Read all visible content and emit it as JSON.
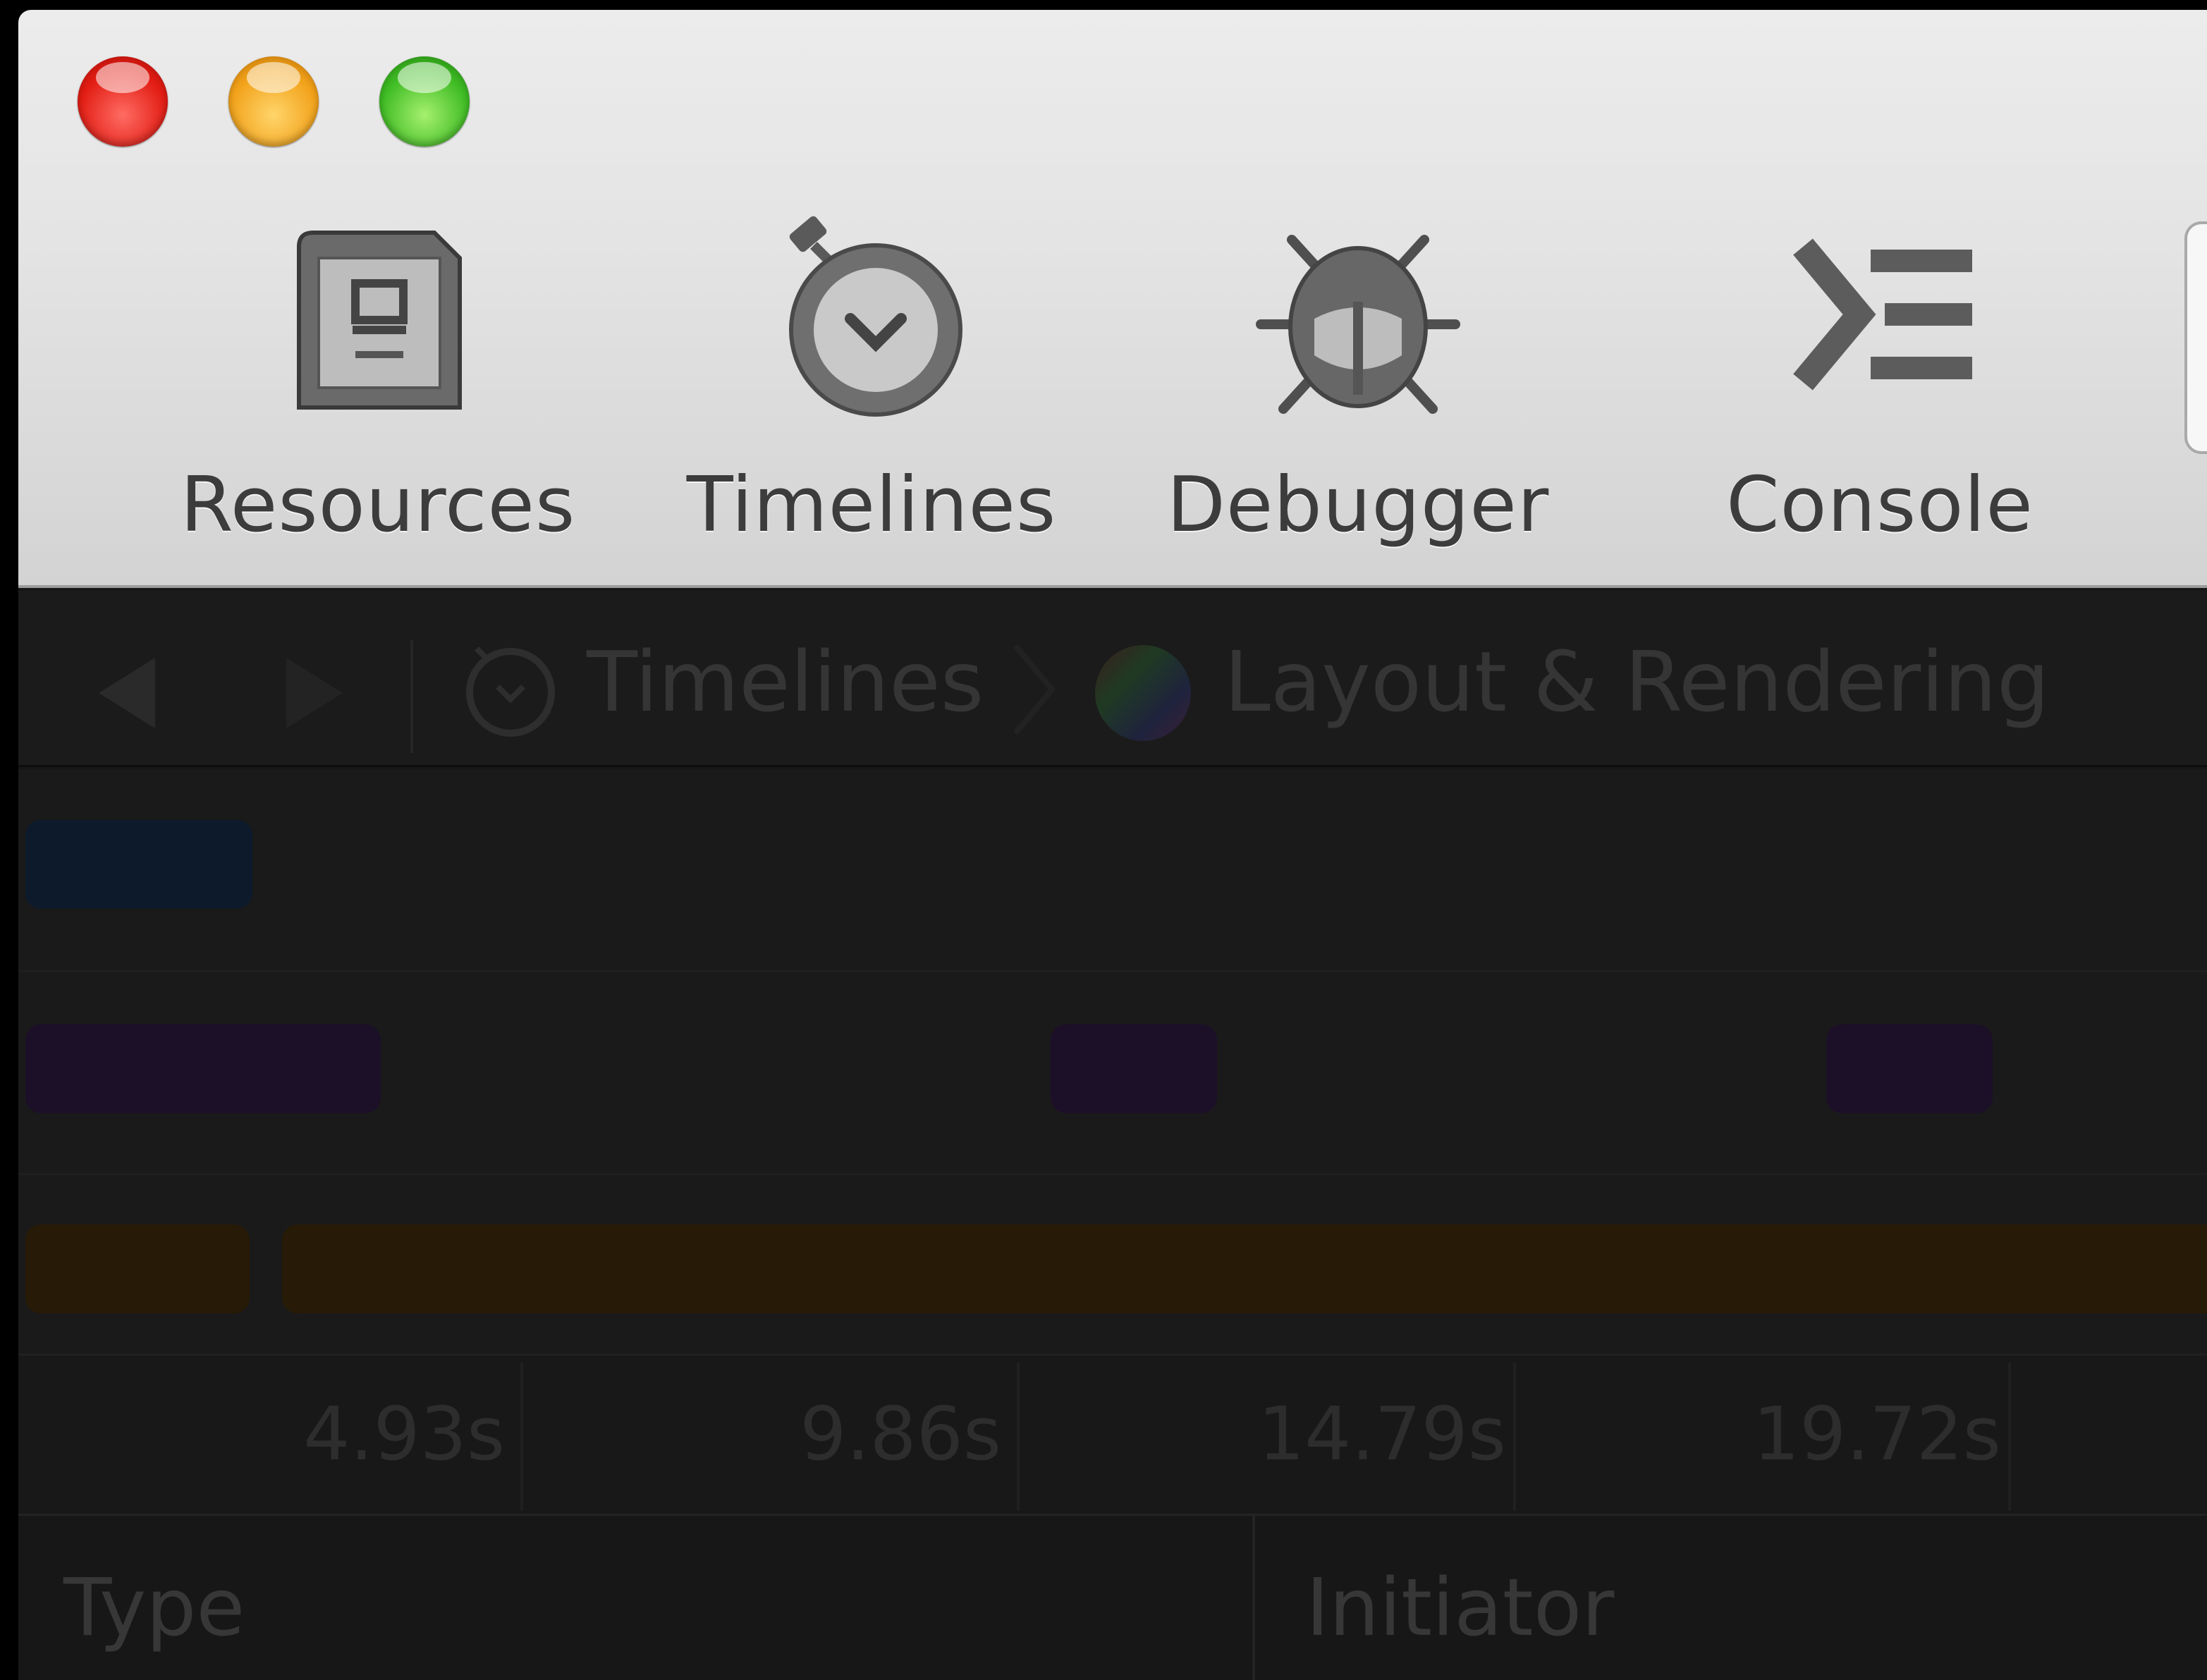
{
  "window": {
    "traffic_lights": [
      {
        "name": "close",
        "color": "#e21d14"
      },
      {
        "name": "minimize",
        "color": "#f2a21a"
      },
      {
        "name": "zoom",
        "color": "#3fbc24"
      }
    ]
  },
  "toolbar": {
    "tabs": [
      {
        "label": "Resources",
        "icon": "resources-icon"
      },
      {
        "label": "Timelines",
        "icon": "stopwatch-icon"
      },
      {
        "label": "Debugger",
        "icon": "bug-icon"
      },
      {
        "label": "Console",
        "icon": "console-icon"
      }
    ]
  },
  "navbar": {
    "back_icon": "back-arrow-icon",
    "forward_icon": "forward-arrow-icon",
    "breadcrumb": [
      {
        "label": "Timelines",
        "icon": "stopwatch-icon"
      },
      {
        "label": "Layout & Rendering",
        "icon": "color-wheel-icon"
      }
    ]
  },
  "timeline": {
    "lanes": [
      {
        "name": "network",
        "color": "#0c1a2c"
      },
      {
        "name": "layout-rendering",
        "color": "#1c0f28"
      },
      {
        "name": "javascript-events",
        "color": "#271a06"
      }
    ],
    "ruler_ticks": [
      "4.93s",
      "9.86s",
      "14.79s",
      "19.72s"
    ]
  },
  "table": {
    "columns": [
      "Type",
      "Initiator"
    ]
  }
}
